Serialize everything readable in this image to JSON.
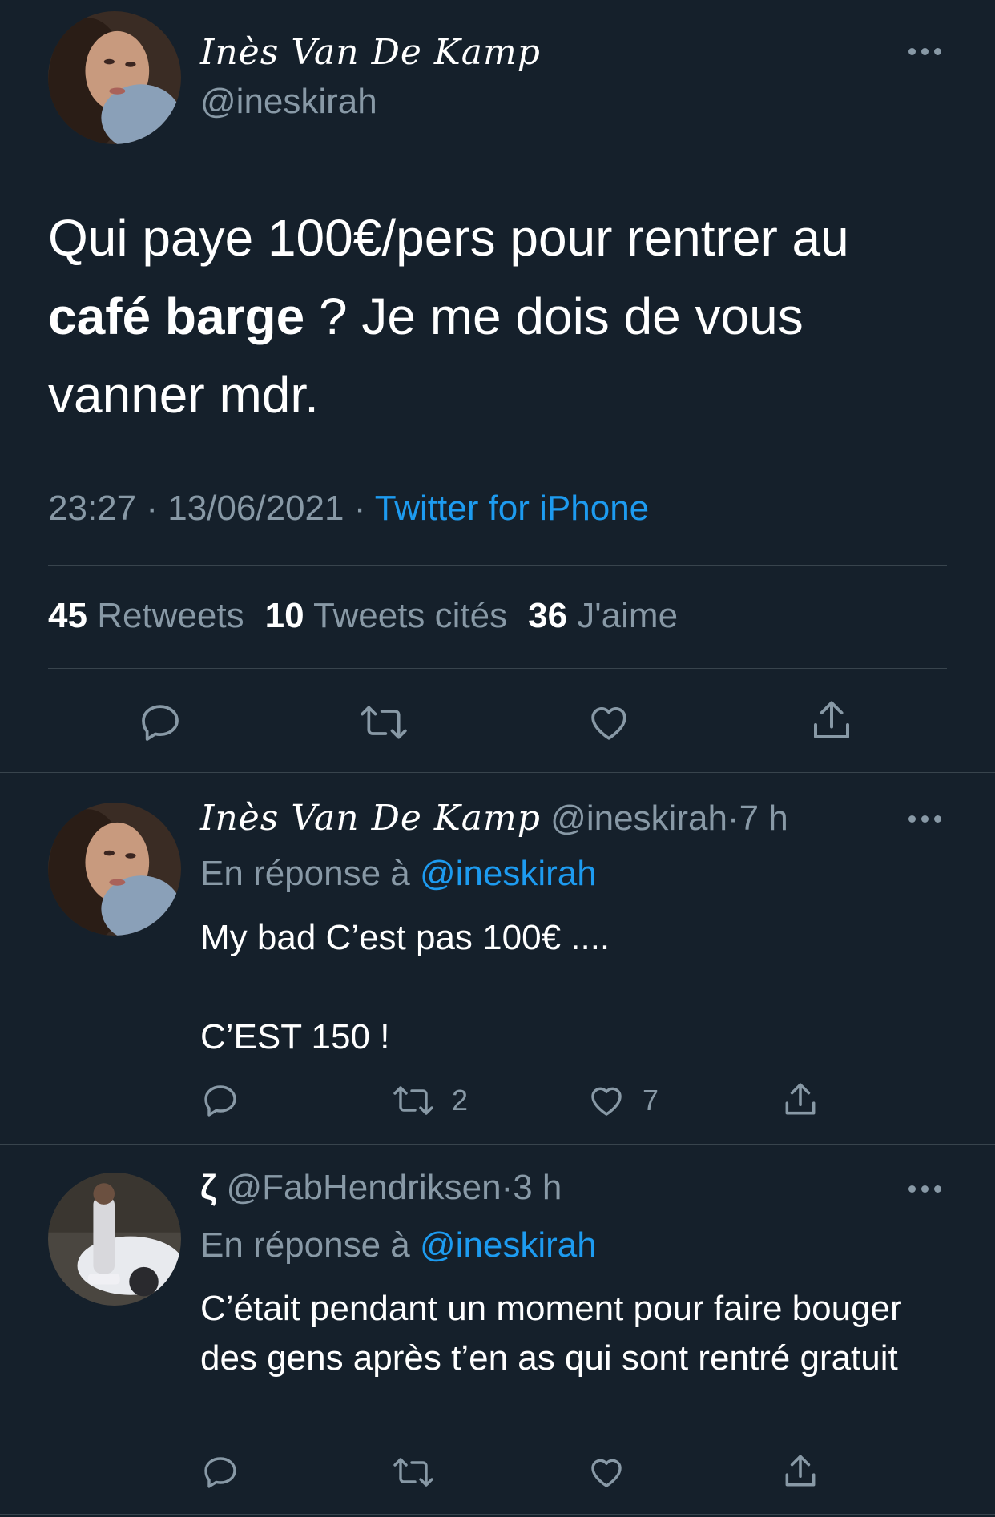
{
  "main_tweet": {
    "author_name": "Inès Van De Kamp",
    "handle": "@ineskirah",
    "text_part1": "Qui paye 100€/pers pour rentrer au ",
    "text_bold": "café barge",
    "text_part2": " ? Je me dois de vous vanner mdr.",
    "time": "23:27",
    "date": "13/06/2021",
    "separator": "·",
    "source": "Twitter for iPhone",
    "stats": {
      "retweets_count": "45",
      "retweets_label": "Retweets",
      "quotes_count": "10",
      "quotes_label": "Tweets cités",
      "likes_count": "36",
      "likes_label": "J'aime"
    }
  },
  "replies": [
    {
      "author_name": "Inès Van De Kamp",
      "handle": "@ineskirah",
      "time": "7 h",
      "separator": "·",
      "reply_prefix": "En réponse à ",
      "reply_to": "@ineskirah",
      "text_line1": "My bad C’est pas 100€ ....",
      "text_line2": "C’EST 150 !",
      "retweet_count": "2",
      "like_count": "7"
    },
    {
      "author_name": "ζ",
      "handle": "@FabHendriksen",
      "time": "3 h",
      "separator": "·",
      "reply_prefix": "En réponse à ",
      "reply_to": "@ineskirah",
      "text": "C’était pendant un moment pour faire bouger des gens après t’en as qui sont rentré gratuit",
      "retweet_count": "",
      "like_count": ""
    }
  ],
  "icons": [
    "reply-icon",
    "retweet-icon",
    "like-icon",
    "share-icon",
    "more-icon"
  ],
  "colors": {
    "background": "#15202b",
    "text": "#ffffff",
    "muted": "#8899a6",
    "link": "#1d9bf0",
    "divider": "#38444d"
  }
}
